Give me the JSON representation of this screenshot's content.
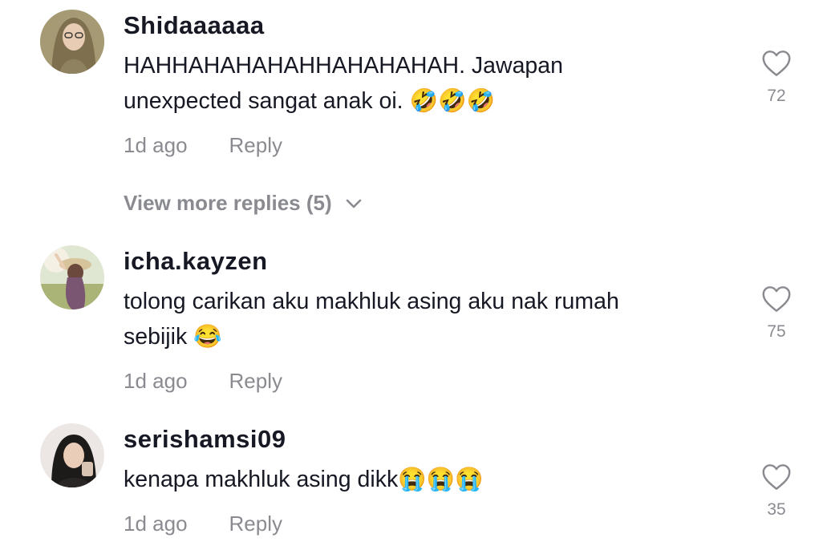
{
  "colors": {
    "text": "#161823",
    "muted": "#8a8b91",
    "heart_outline": "#8a8b91"
  },
  "comments": [
    {
      "username": "Shidaaaaaa",
      "text": "HAHHAHAHAHAHHAHAHAHAH. Jawapan\nunexpected sangat anak oi. 🤣🤣🤣",
      "time": "1d ago",
      "reply_label": "Reply",
      "likes": "72",
      "avatar_icon": "avatar-photo"
    },
    {
      "username": "icha.kayzen",
      "text": "tolong carikan aku makhluk asing aku nak rumah\nsebijik 😂",
      "time": "1d ago",
      "reply_label": "Reply",
      "likes": "75",
      "avatar_icon": "avatar-photo"
    },
    {
      "username": "serishamsi09",
      "text": "kenapa makhluk asing dikk😭😭😭",
      "time": "1d ago",
      "reply_label": "Reply",
      "likes": "35",
      "avatar_icon": "avatar-photo"
    }
  ],
  "view_more": {
    "label": "View more replies (5)",
    "icon": "chevron-down-icon"
  },
  "like_icon": "heart-outline-icon"
}
